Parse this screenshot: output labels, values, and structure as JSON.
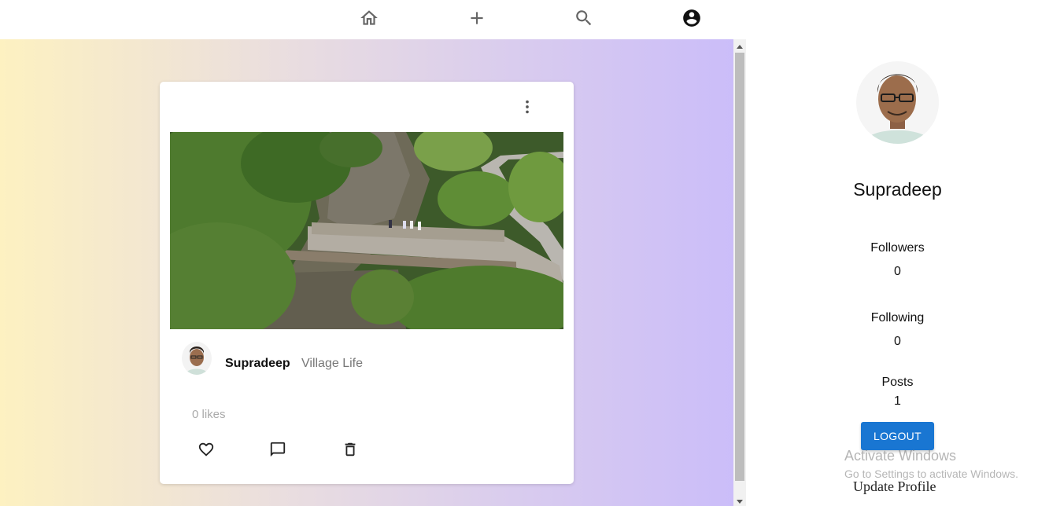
{
  "nav": {
    "icons": [
      "home-icon",
      "add-icon",
      "search-icon",
      "account-circle-icon"
    ]
  },
  "post": {
    "author": "Supradeep",
    "caption": "Village Life",
    "likes": "0 likes",
    "actions": [
      "heart-icon",
      "comment-icon",
      "delete-icon"
    ]
  },
  "profile": {
    "name": "Supradeep",
    "followers_label": "Followers",
    "followers_value": "0",
    "following_label": "Following",
    "following_value": "0",
    "posts_label": "Posts",
    "posts_value": "1",
    "logout_label": "LOGOUT",
    "update_label": "Update Profile"
  },
  "watermark": {
    "title": "Activate Windows",
    "subtitle": "Go to Settings to activate Windows."
  },
  "colors": {
    "accent": "#1976d2",
    "gradient_start": "#fdf1c1",
    "gradient_end": "#cbbdf9"
  }
}
